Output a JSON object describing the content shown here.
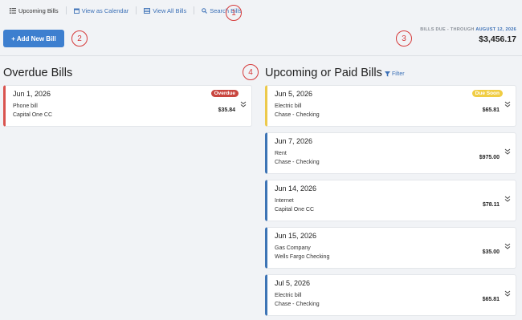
{
  "nav": {
    "items": [
      {
        "label": "Upcoming Bills",
        "icon": "list-icon",
        "active": true
      },
      {
        "label": "View as Calendar",
        "icon": "calendar-icon"
      },
      {
        "label": "View All Bills",
        "icon": "table-icon"
      },
      {
        "label": "Search Bills",
        "icon": "search-icon"
      }
    ]
  },
  "callouts": [
    "1",
    "2",
    "3",
    "4"
  ],
  "toolbar": {
    "add_label": "+ Add New Bill"
  },
  "summary": {
    "label": "BILLS DUE - THROUGH",
    "date": "AUGUST 12, 2026",
    "amount": "$3,456.17"
  },
  "overdue": {
    "title": "Overdue Bills",
    "bills": [
      {
        "date": "Jun 1, 2026",
        "name": "Phone bill",
        "account": "Capital One CC",
        "amount": "$35.84",
        "badge": "Overdue"
      }
    ]
  },
  "upcoming": {
    "title": "Upcoming or Paid Bills",
    "filter_label": "Filter",
    "bills": [
      {
        "date": "Jun 5, 2026",
        "name": "Electric bill",
        "account": "Chase - Checking",
        "amount": "$65.81",
        "badge": "Due Soon"
      },
      {
        "date": "Jun 7, 2026",
        "name": "Rent",
        "account": "Chase - Checking",
        "amount": "$975.00"
      },
      {
        "date": "Jun 14, 2026",
        "name": "Internet",
        "account": "Capital One CC",
        "amount": "$78.11"
      },
      {
        "date": "Jun 15, 2026",
        "name": "Gas Company",
        "account": "Wells Fargo Checking",
        "amount": "$35.00"
      },
      {
        "date": "Jul 5, 2026",
        "name": "Electric bill",
        "account": "Chase - Checking",
        "amount": "$65.81"
      }
    ]
  },
  "colors": {
    "accent": "#3d7fcf",
    "overdue": "#d9534f",
    "due_soon": "#ecc94b",
    "card_border": "#3d74b5"
  }
}
